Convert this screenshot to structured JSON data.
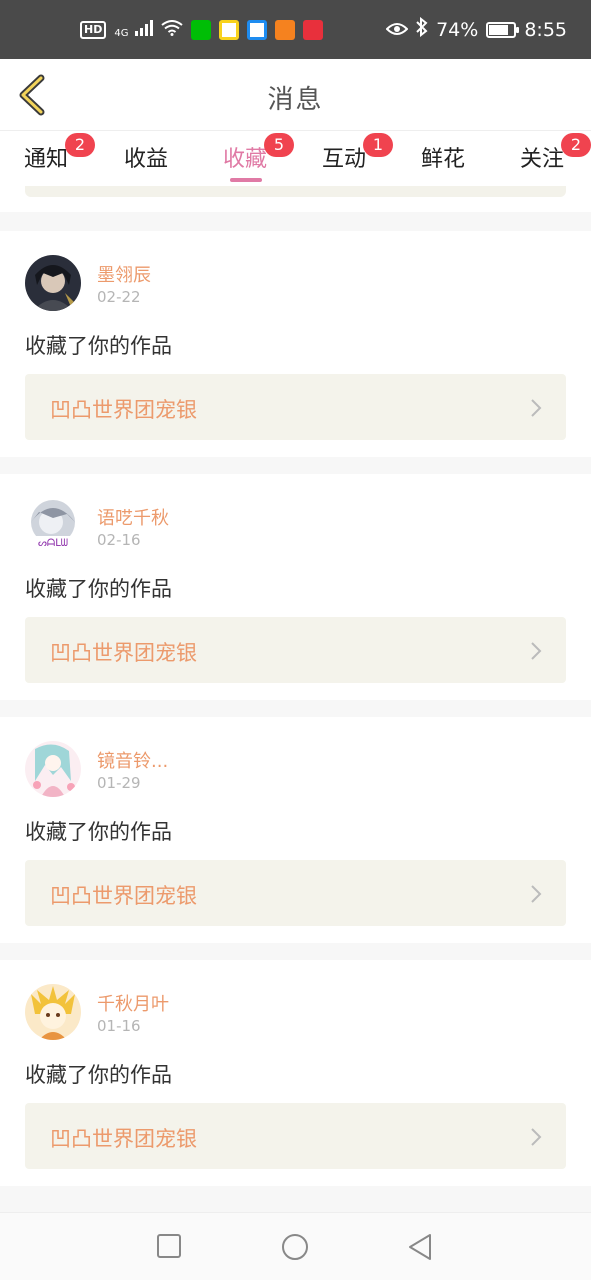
{
  "status_bar": {
    "hd": "HD",
    "network": "4G",
    "battery": "74%",
    "time": "8:55",
    "icons": [
      "hd-icon",
      "signal-icon",
      "wifi-icon",
      "iqiyi-app-icon",
      "green-app-icon",
      "blue-app-icon",
      "orange-app-icon",
      "red-app-icon",
      "eye-icon",
      "bluetooth-icon",
      "battery-icon"
    ]
  },
  "header": {
    "title": "消息",
    "back_icon": "chevron-left-icon"
  },
  "tabs": [
    {
      "label": "通知",
      "badge": "2"
    },
    {
      "label": "收益",
      "badge": ""
    },
    {
      "label": "收藏",
      "badge": "5",
      "active": true
    },
    {
      "label": "互动",
      "badge": "1"
    },
    {
      "label": "鲜花",
      "badge": ""
    },
    {
      "label": "关注",
      "badge": "2"
    }
  ],
  "colors": {
    "accent_pink": "#e07aa5",
    "name_orange": "#ec9a6c",
    "badge_red": "#f0434f",
    "card_box": "#f4f3eb"
  },
  "notifications": [
    {
      "user": "墨翎辰",
      "date": "02-22",
      "action": "收藏了你的作品",
      "work": "凹凸世界团宠银"
    },
    {
      "user": "语呓千秋",
      "date": "02-16",
      "action": "收藏了你的作品",
      "work": "凹凸世界团宠银"
    },
    {
      "user": "镜音铃...",
      "date": "01-29",
      "action": "收藏了你的作品",
      "work": "凹凸世界团宠银"
    },
    {
      "user": "千秋月叶",
      "date": "01-16",
      "action": "收藏了你的作品",
      "work": "凹凸世界团宠银"
    }
  ],
  "nav_bar": {
    "icons": [
      "recent-apps-icon",
      "home-icon",
      "back-icon"
    ]
  }
}
